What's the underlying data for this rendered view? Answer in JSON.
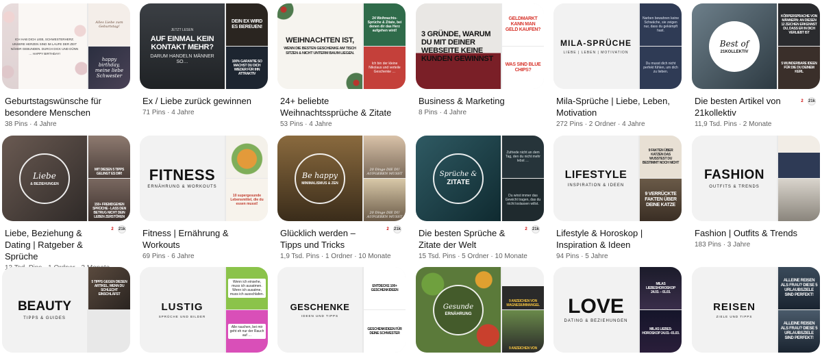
{
  "boards": [
    {
      "title": "Geburtstagswünsche für besondere Menschen",
      "meta": "38 Pins · 4 Jahre",
      "main_text": "ICH HAB DICH LIEB, SCHWESTERHERZ. UNSERE HERZEN SIND IM LAUFE DER ZEIT NÄHER GEBUNDEN. DURCH DICK UND DÜNN … HAPPY BIRTHDAY!",
      "side_top": "Alles Liebe zum Geburtstag!",
      "side_bot": "happy birthday, meine liebe Schwester"
    },
    {
      "title": "Ex / Liebe zurück gewinnen",
      "meta": "71 Pins · 4 Jahre",
      "main_small": "JETZT LESEN",
      "main_text": "AUF EINMAL KEIN KONTAKT MEHR?",
      "main_sub": "DARUM HANDELN MÄNNER SO…",
      "side_top": "DEIN EX WIRD ES BEREUEN!",
      "side_bot": "100% GARANTIE SO MACHST DU DICH WIEDER FÜR IHN ATTRAKTIV"
    },
    {
      "title": "24+ beliebte Weihnachtssprüche & Zitate",
      "meta": "53 Pins · 4 Jahre",
      "main_text": "WEIHNACHTEN IST,",
      "main_sub": "WENN DIE BESTEN GESCHENKE AM TISCH SITZEN & NICHT UNTERM BAUM LIEGEN.",
      "side_top": "24 Weihnachts-Sprüche & Zitate, bei denen dir das Herz aufgehen wird!",
      "side_bot": "Ich bin der kleine Nikolaus und verteile Geschenke …"
    },
    {
      "title": "Business & Marketing",
      "meta": "8 Pins · 4 Jahre",
      "main_text": "3 GRÜNDE, WARUM DU MIT DEINER WEBSEITE KEINE KUNDEN GEWINNST",
      "side_top": "GELDMARKT KANN MAN GELD KAUFEN?",
      "side_bot": "WAS SIND BLUE CHIPS?"
    },
    {
      "title": "Mila-Sprüche | Liebe, Leben, Motivation",
      "meta": "272 Pins · 2 Ordner · 4 Jahre",
      "main_text": "MILA-SPRÜCHE",
      "main_sub": "LIEBE | LEBEN | MOTIVATION",
      "side_top": "Narben bewahren keine Schwäche, sie zeigen nur, dass du gekämpft hast.",
      "side_bot": "Du musst dich nicht perfekt fühlen, um dich zu lieben."
    },
    {
      "title": "Die besten Artikel von 21kollektiv",
      "meta": "11,9 Tsd. Pins · 2 Monate",
      "main_text": "Best of",
      "main_sub": "21KOLLEKTIV",
      "side_top": "Körpersprache von Männern: AN DIESEN 12 ZEICHEN ERKENNST DU, DASS ER IN DICH VERLIEBT IST",
      "side_bot": "5 WUNDERBARE IDEEN FÜR DIE DU DEINEM KERL"
    },
    {
      "title": "Liebe, Beziehung & Dating | Ratgeber & Sprüche",
      "meta": "13 Tsd. Pins · 1 Ordner · 2 Monate",
      "main_text": "Liebe",
      "main_sub": "& BEZIEHUNGEN",
      "side_top": "MIT DIESEN 5 TIPPS GELINGT ES DIR!",
      "side_bot": "150+ FREMDGEHEN SPRÜCHE - LASS DEN BETRUG NICHT DEIN LEBEN ZERSTÖREN"
    },
    {
      "title": "Fitness | Ernährung & Workouts",
      "meta": "69 Pins · 6 Jahre",
      "main_text": "FITNESS",
      "main_sub": "ERNÄHRUNG & WORKOUTS",
      "side_top": "",
      "side_bot": "10 supergesunde Lebensmittel, die du essen musst!"
    },
    {
      "title": "Glücklich werden – Tipps und Tricks",
      "meta": "1,9 Tsd. Pins · 1 Ordner · 10 Monate",
      "main_text": "Be happy",
      "main_sub": "MINIMALISMUS & ZEN",
      "side_top": "20 Dinge DIE DU AUFGEBEN MUSST",
      "side_bot": "20 Dinge DIE DU AUFGEBEN MUSST"
    },
    {
      "title": "Die besten Sprüche & Zitate der Welt",
      "meta": "15 Tsd. Pins · 5 Ordner · 10 Monate",
      "main_text": "Sprüche &",
      "main_sub": "ZITATE",
      "side_top": "Zufriede nicht an dem Tag, den du nicht mehr lebst …",
      "side_bot": "Du wirst immer das Gewicht tragen, das du nicht loslassen willst."
    },
    {
      "title": "Lifestyle & Horoskop | Inspiration & Ideen",
      "meta": "94 Pins · 5 Jahre",
      "main_text": "LIFESTYLE",
      "main_sub": "INSPIRATION & IDEEN",
      "side_top": "9 FAKTEN ÜBER KATZEN Das wusstest du bestimmt noch nicht",
      "side_bot": "9 VERRÜCKTE FAKTEN ÜBER DEINE KATZE"
    },
    {
      "title": "Fashion | Outfits & Trends",
      "meta": "183 Pins · 3 Jahre",
      "main_text": "FASHION",
      "main_sub": "OUTFITS & TRENDS",
      "side_top": "",
      "side_bot": ""
    },
    {
      "title": "",
      "meta": "",
      "main_text": "BEAUTY",
      "main_sub": "TIPPS & GUIDES",
      "side_top": "5 TIPPS Gegen diesen Artikel, wenn du schlecht einschläfst",
      "side_bot": ""
    },
    {
      "title": "",
      "meta": "",
      "main_text": "LUSTIG",
      "main_sub": "SPRÜCHE UND BILDER",
      "side_top": "Wenn ich einsehe, muss ich ausatmen. Wenn ich ausatme, muss ich ausschlafen.",
      "side_bot": "Alle rauchen, bei mir geht eh nur der Rauch auf …"
    },
    {
      "title": "",
      "meta": "",
      "main_text": "GESCHENKE",
      "main_sub": "IDEEN UND TIPPS",
      "side_top": "ENTDECKE 100+ GESCHENKIDEEN",
      "side_bot": "GESCHENKIDEEN FÜR DEINE SCHWESTER"
    },
    {
      "title": "",
      "meta": "",
      "main_text": "Gesunde",
      "main_sub": "ERNÄHRUNG",
      "side_top": "9 ANZEICHEN VON MAGNESIUMMANGEL",
      "side_bot": "9 ANZEICHEN VON"
    },
    {
      "title": "",
      "meta": "",
      "main_text": "LOVE",
      "main_sub": "DATING & BEZIEHUNGEN",
      "side_top": "MILAS LIEBESHOROSKOP 24.03. – 01.03.",
      "side_bot": "MILAS LIEBES-HOROSKOP 24.03.–01.03."
    },
    {
      "title": "",
      "meta": "",
      "main_text": "REISEN",
      "main_sub": "ZIELE UND TIPPS",
      "side_top": "ALLEINE REISEN ALS FRAU? DIESE 5 URLAUBSZIELE SIND PERFEKT!",
      "side_bot": "ALLEINE REISEN ALS FRAU? DIESE 5 URLAUBSZIELE SIND PERFEKT!"
    }
  ],
  "avatar_badge": "2",
  "avatar_label": "21k",
  "colors": {
    "text": "#111111",
    "meta": "#5f5f5f",
    "tile_bg": "#e9e9e9"
  }
}
